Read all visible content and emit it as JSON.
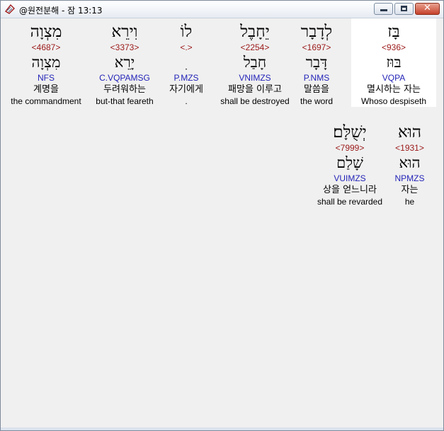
{
  "window": {
    "title": "@원전분해 - 잠 13:13"
  },
  "row1": [
    {
      "heb1": "בָּז",
      "strong": "<936>",
      "heb2": "בּוּז",
      "morph": "VQPA",
      "ko": "멸시하는 자는",
      "en": "Whoso despiseth"
    },
    {
      "heb1": "לְדָבָר",
      "strong": "<1697>",
      "heb2": "דָּבָר",
      "morph": "P.NMS",
      "ko": "말씀을",
      "en": "the word"
    },
    {
      "heb1": "יֵחָבֶל",
      "strong": "<2254>",
      "heb2": "חָבַל",
      "morph": "VNIMZS",
      "ko": "패망을 이루고",
      "en": "shall be destroyed"
    },
    {
      "heb1": "לוֹ",
      "strong": "<.>",
      "heb2": "ִ",
      "morph": "P.MZS",
      "ko": "자기에게",
      "en": "."
    },
    {
      "heb1": "וִירֵא",
      "strong": "<3373>",
      "heb2": "יָרֵא",
      "morph": "C.VQPAMSG",
      "ko": "두려워하는",
      "en": "but-that feareth"
    },
    {
      "heb1": "מִצְוָה",
      "strong": "<4687>",
      "heb2": "מִצְוָה",
      "morph": "NFS",
      "ko": "계명을",
      "en": "the commandment"
    }
  ],
  "row2": [
    {
      "heb1": "הוּא",
      "strong": "<1931>",
      "heb2": "הוּא",
      "morph": "NPMZS",
      "ko": "자는",
      "en": "he"
    },
    {
      "heb1": "יְשֻׁלָּם׃",
      "strong": "<7999>",
      "heb2": "שָׁלַם",
      "morph": "VUIMZS",
      "ko": "상을 얻느니라",
      "en": "shall be revarded"
    }
  ]
}
